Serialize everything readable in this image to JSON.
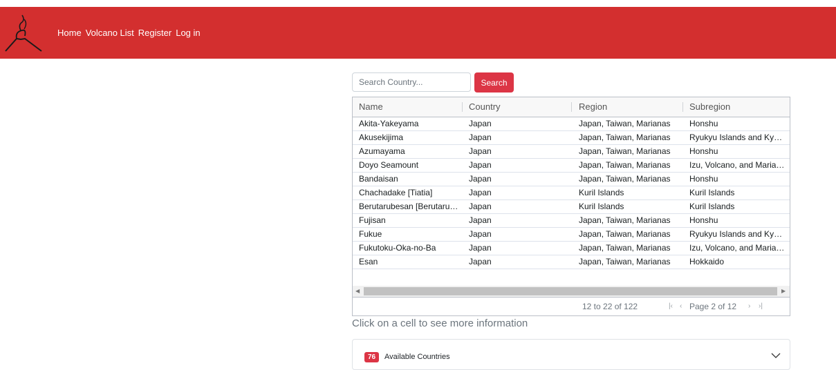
{
  "nav": {
    "links": [
      "Home",
      "Volcano List",
      "Register",
      "Log in"
    ]
  },
  "search": {
    "placeholder": "Search Country...",
    "button_label": "Search"
  },
  "grid": {
    "columns": [
      "Name",
      "Country",
      "Region",
      "Subregion"
    ],
    "rows": [
      [
        "Akita-Yakeyama",
        "Japan",
        "Japan, Taiwan, Marianas",
        "Honshu"
      ],
      [
        "Akusekijima",
        "Japan",
        "Japan, Taiwan, Marianas",
        "Ryukyu Islands and Kyushu"
      ],
      [
        "Azumayama",
        "Japan",
        "Japan, Taiwan, Marianas",
        "Honshu"
      ],
      [
        "Doyo Seamount",
        "Japan",
        "Japan, Taiwan, Marianas",
        "Izu, Volcano, and Mariana Islands"
      ],
      [
        "Bandaisan",
        "Japan",
        "Japan, Taiwan, Marianas",
        "Honshu"
      ],
      [
        "Chachadake [Tiatia]",
        "Japan",
        "Kuril Islands",
        "Kuril Islands"
      ],
      [
        "Berutarubesan [Berutarube]",
        "Japan",
        "Kuril Islands",
        "Kuril Islands"
      ],
      [
        "Fujisan",
        "Japan",
        "Japan, Taiwan, Marianas",
        "Honshu"
      ],
      [
        "Fukue",
        "Japan",
        "Japan, Taiwan, Marianas",
        "Ryukyu Islands and Kyushu"
      ],
      [
        "Fukutoku-Oka-no-Ba",
        "Japan",
        "Japan, Taiwan, Marianas",
        "Izu, Volcano, and Mariana Islands"
      ],
      [
        "Esan",
        "Japan",
        "Japan, Taiwan, Marianas",
        "Hokkaido"
      ]
    ],
    "pagination": {
      "range": "12 to 22 of 122",
      "page": "Page 2 of 12"
    }
  },
  "hint": "Click on a cell to see more information",
  "accordion": {
    "count": "76",
    "label": "Available Countries"
  },
  "colors": {
    "brand": "#d32f2f",
    "accent": "#dc3545"
  },
  "icons": [
    "volcano-logo-icon",
    "first-page-icon",
    "previous-page-icon",
    "next-page-icon",
    "last-page-icon",
    "chevron-down-icon"
  ]
}
